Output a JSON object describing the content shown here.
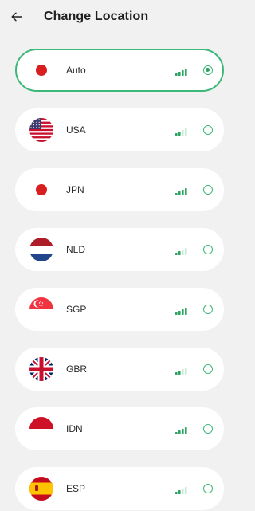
{
  "header": {
    "back_icon": "arrow-left-icon",
    "title": "Change Location"
  },
  "colors": {
    "accent": "#3cb878",
    "signal_strong": "#2aa460",
    "signal_weak": "#c8ecd6"
  },
  "locations": [
    {
      "name": "Auto",
      "flag": "japan-flag-icon",
      "signal": 4,
      "selected": true
    },
    {
      "name": "USA",
      "flag": "usa-flag-icon",
      "signal": 2,
      "selected": false
    },
    {
      "name": "JPN",
      "flag": "japan-flag-icon",
      "signal": 4,
      "selected": false
    },
    {
      "name": "NLD",
      "flag": "netherlands-flag-icon",
      "signal": 2,
      "selected": false
    },
    {
      "name": "SGP",
      "flag": "singapore-flag-icon",
      "signal": 4,
      "selected": false
    },
    {
      "name": "GBR",
      "flag": "uk-flag-icon",
      "signal": 2,
      "selected": false
    },
    {
      "name": "IDN",
      "flag": "indonesia-flag-icon",
      "signal": 4,
      "selected": false
    },
    {
      "name": "ESP",
      "flag": "spain-flag-icon",
      "signal": 2,
      "selected": false
    }
  ]
}
